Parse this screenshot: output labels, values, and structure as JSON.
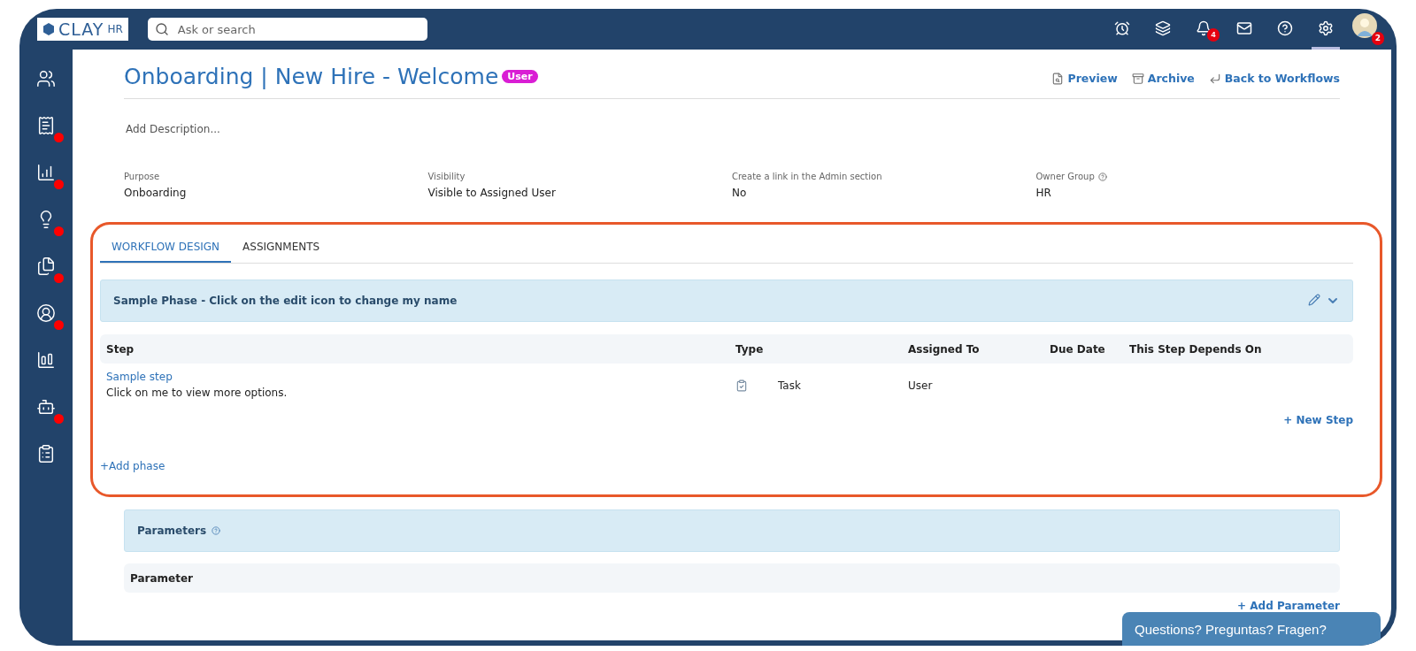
{
  "topbar": {
    "logo": {
      "word": "CLAY",
      "suffix": "HR"
    },
    "search": {
      "placeholder": "Ask or search"
    },
    "icons": [
      {
        "selected": false
      },
      {
        "selected": false
      },
      {
        "badge": "4",
        "selected": false
      },
      {
        "selected": false
      },
      {
        "selected": false
      },
      {
        "selected": true
      }
    ],
    "avatar": {
      "badge": "2"
    }
  },
  "sidebar": {
    "items": [
      {
        "notification": false
      },
      {
        "notification": true
      },
      {
        "notification": true
      },
      {
        "notification": true
      },
      {
        "notification": true
      },
      {
        "notification": true
      },
      {
        "notification": false
      },
      {
        "notification": true
      },
      {
        "notification": false
      }
    ]
  },
  "header": {
    "title": "Onboarding | New Hire - Welcome",
    "tag": "User",
    "actions": [
      "Preview",
      "Archive",
      "Back to Workflows"
    ]
  },
  "description": {
    "placeholder": "Add Description..."
  },
  "details": [
    {
      "label": "Purpose",
      "value": "Onboarding",
      "help": false
    },
    {
      "label": "Visibility",
      "value": "Visible to Assigned User",
      "help": false
    },
    {
      "label": "Create a link in the Admin section",
      "value": "No",
      "help": false
    },
    {
      "label": "Owner Group",
      "value": "HR",
      "help": true
    }
  ],
  "tabs": [
    {
      "label": "WORKFLOW DESIGN",
      "selected": true
    },
    {
      "label": "ASSIGNMENTS",
      "selected": false
    }
  ],
  "phase": {
    "title": "Sample Phase - Click on the edit icon to change my name",
    "expanded": true,
    "columns": [
      "Step",
      "Type",
      "Assigned To",
      "Due Date",
      "This Step Depends On"
    ],
    "rows": [
      {
        "step": "Sample step",
        "note": "Click on me to view more options.",
        "type": "Task",
        "assigned_to": "User"
      }
    ],
    "new_step": "+ New Step"
  },
  "add_phase": "+Add phase",
  "parameters": {
    "title": "Parameters",
    "columns": [
      "Parameter"
    ],
    "add": "+ Add Parameter"
  },
  "chat_button": "Questions? Preguntas? Fragen?"
}
